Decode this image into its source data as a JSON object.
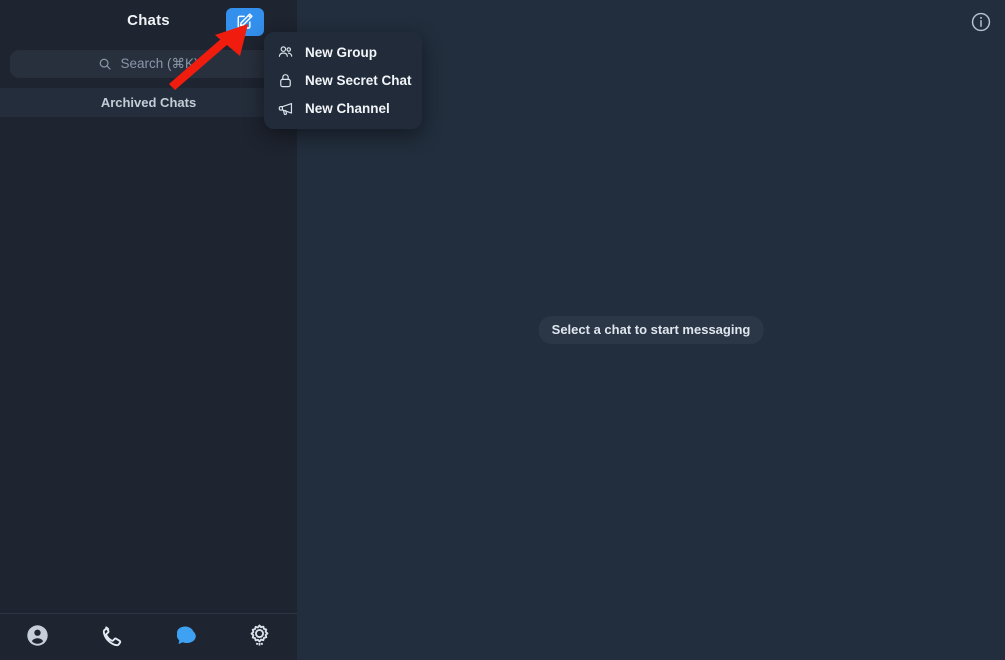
{
  "window": {
    "accent_color": "#3390ec",
    "sidebar_bg": "#1e2430",
    "main_bg": "#222e3d",
    "annotation_color": "#f01d0e"
  },
  "sidebar": {
    "title": "Chats",
    "compose_button": {
      "label": "New Message",
      "icon": "compose-pencil-icon"
    },
    "search": {
      "placeholder": "Search (⌘K)",
      "value": "",
      "icon": "search-icon"
    },
    "archived": {
      "label": "Archived Chats"
    },
    "tabs": [
      {
        "name": "contacts",
        "icon": "contact-person-icon",
        "active": false
      },
      {
        "name": "calls",
        "icon": "phone-icon",
        "active": false
      },
      {
        "name": "chats",
        "icon": "chat-bubbles-icon",
        "active": true
      },
      {
        "name": "settings",
        "icon": "gear-icon",
        "active": false
      }
    ]
  },
  "new_menu": {
    "items": [
      {
        "label": "New Group",
        "icon": "group-people-icon"
      },
      {
        "label": "New Secret Chat",
        "icon": "lock-icon"
      },
      {
        "label": "New Channel",
        "icon": "megaphone-icon"
      }
    ]
  },
  "main": {
    "empty_state": "Select a chat to start messaging",
    "info_button": {
      "icon": "info-circle-icon"
    }
  },
  "annotation": {
    "type": "arrow",
    "points_to": "compose-button",
    "color": "#f01d0e"
  }
}
